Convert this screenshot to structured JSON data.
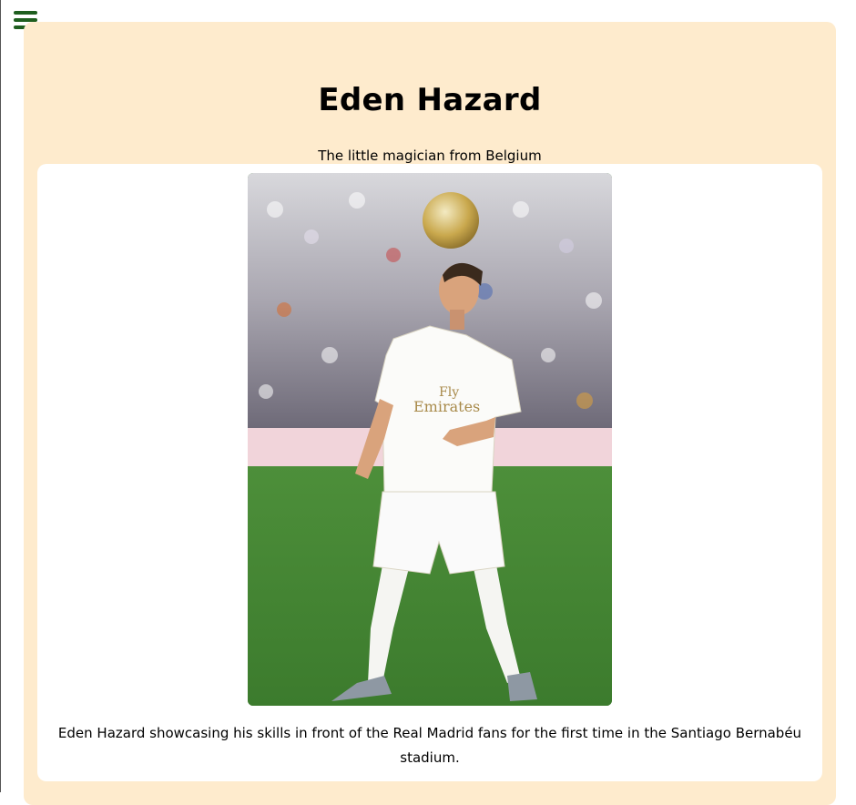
{
  "nav": {
    "menu_icon": "hamburger-menu-icon",
    "menu_color": "#1f5e1f"
  },
  "header": {
    "title": "Eden Hazard",
    "subtitle": "The little magician from Belgium"
  },
  "figure": {
    "image_description_alt": "Eden Hazard juggling a football at the Santiago Bernabéu",
    "caption": "Eden Hazard showcasing his skills in front of the Real Madrid fans for the first time in the Santiago Bernabéu stadium."
  },
  "theme": {
    "panel_color": "#feebcd",
    "card_color": "#ffffff"
  }
}
